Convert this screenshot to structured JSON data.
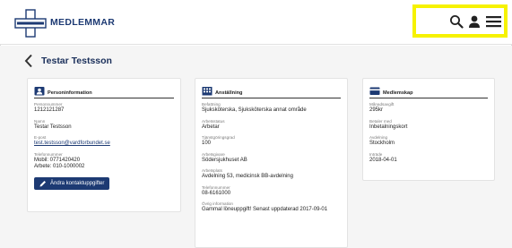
{
  "header": {
    "brand": "MEDLEMMAR",
    "icons": [
      "search-icon",
      "user-icon",
      "menu-icon"
    ],
    "highlight_color": "#f6f200"
  },
  "page": {
    "title": "Testar Testsson"
  },
  "cards": {
    "person": {
      "title": "Personinformation",
      "personnummer_label": "Personnummer",
      "personnummer": "1212121287",
      "namn_label": "Namn",
      "namn": "Testar Testsson",
      "epost_label": "E-post",
      "epost": "test.testsson@vardforbundet.se",
      "telefon_label": "Telefonnummer",
      "telefon_mobil": "Mobil: 0771420420",
      "telefon_arbete": "Arbete: 010-1000002",
      "button": "Ändra kontaktuppgifter"
    },
    "employment": {
      "title": "Anställning",
      "befattning_label": "Befattning",
      "befattning": "Sjuksköterska, Sjuksköterska annat område",
      "status_label": "Arbetsstatus",
      "status": "Arbetar",
      "grad_label": "Tjänstgöringsgrad",
      "grad": "100",
      "givare_label": "Arbetsgivare",
      "givare": "Södersjukhuset AB",
      "plats_label": "Arbetsplats",
      "plats": "Avdelning 53, medicinsk BB-avdelning",
      "tel_label": "Telefonnummer",
      "tel": "08-6161000",
      "ovrig_label": "Övrig information",
      "ovrig": "Gammal löneuppgift! Senast uppdaterad 2017-09-01"
    },
    "membership": {
      "title": "Medlemskap",
      "avgift_label": "Månadsavgift",
      "avgift": "295kr",
      "betaler_label": "Betaler med",
      "betaler": "Inbetalningskort",
      "avdelning_label": "Avdelning",
      "avdelning": "Stockholm",
      "intrade_label": "Inträde",
      "intrade": "2018-04-01"
    }
  },
  "colors": {
    "brand": "#1d3a73",
    "background": "#f5f5f5"
  }
}
